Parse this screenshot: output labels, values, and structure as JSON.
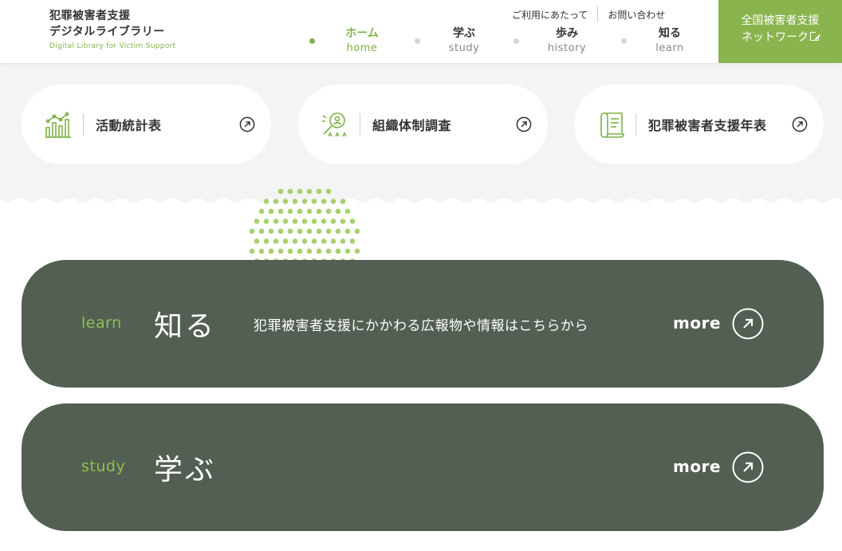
{
  "header": {
    "logo_line1": "犯罪被害者支援",
    "logo_line2": "デジタルライブラリー",
    "logo_sub": "Digital Library for Victim Support",
    "utility_links": [
      "ご利用にあたって",
      "お問い合わせ"
    ],
    "nav": [
      {
        "jp": "ホーム",
        "en": "home",
        "active": true
      },
      {
        "jp": "学ぶ",
        "en": "study",
        "active": false
      },
      {
        "jp": "歩み",
        "en": "history",
        "active": false
      },
      {
        "jp": "知る",
        "en": "learn",
        "active": false
      }
    ],
    "cta_line1": "全国被害者支援",
    "cta_line2": "ネットワーク"
  },
  "quick_links": [
    {
      "label": "活動統計表",
      "icon": "bar-chart-icon"
    },
    {
      "label": "組織体制調査",
      "icon": "magnifier-people-icon"
    },
    {
      "label": "犯罪被害者支援年表",
      "icon": "scroll-icon"
    }
  ],
  "cards": [
    {
      "en": "learn",
      "jp": "知る",
      "desc": "犯罪被害者支援にかかわる広報物や情報はこちらから",
      "more": "more"
    },
    {
      "en": "study",
      "jp": "学ぶ",
      "desc": "",
      "more": "more"
    }
  ],
  "colors": {
    "accent_green": "#7fb147",
    "cta_green": "#8ab54e",
    "card_bg": "#525f52",
    "band_gray": "#f4f4f4"
  }
}
